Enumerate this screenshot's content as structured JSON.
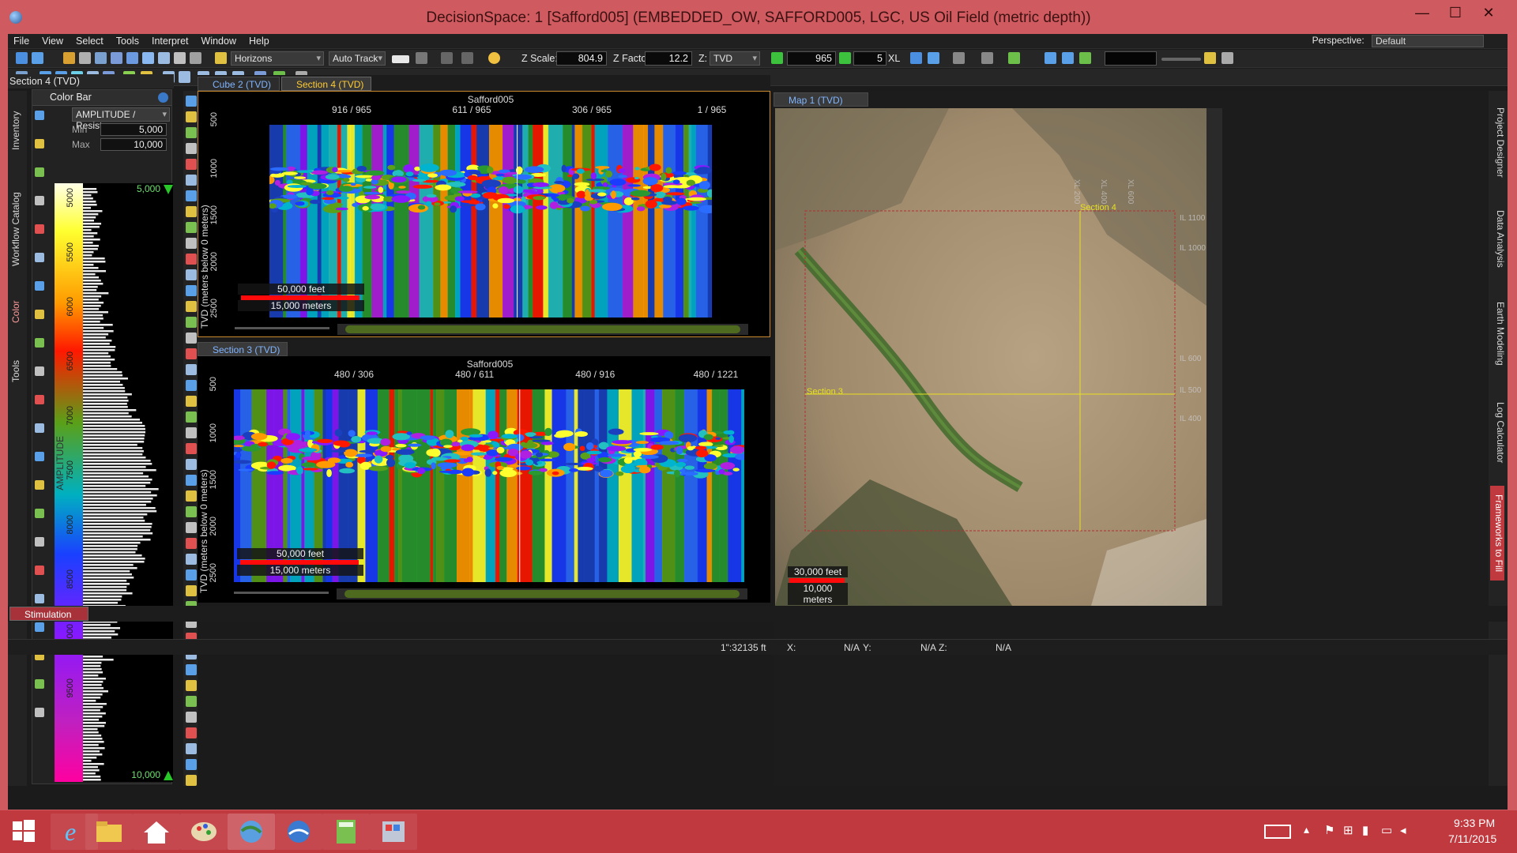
{
  "window": {
    "title": "DecisionSpace: 1 [Safford005] (EMBEDDED_OW, SAFFORD005, LGC, US Oil Field (metric depth))",
    "minimize": "—",
    "maximize": "☐",
    "close": "✕"
  },
  "menu": {
    "items": [
      "File",
      "View",
      "Select",
      "Tools",
      "Interpret",
      "Window",
      "Help"
    ],
    "perspective_label": "Perspective:",
    "perspective_value": "Default"
  },
  "toolbar": {
    "horizons": "Horizons",
    "auto_track": "Auto Track",
    "z_scale_label": "Z Scale:",
    "z_scale_value": "804.9",
    "z_factor_label": "Z Factor:",
    "z_factor_value": "12.2",
    "z_label": "Z:",
    "z_value": "TVD",
    "line_value": "965",
    "step_value": "5",
    "xl_label": "XL"
  },
  "left": {
    "section_title": "Section 4 (TVD)",
    "vertical_tabs": [
      "Inventory",
      "Workflow Catalog",
      "Color",
      "Tools"
    ],
    "color_bar": {
      "title": "Color Bar",
      "attribute": "AMPLITUDE / Resist...",
      "min_label": "Min",
      "min_value": "5,000",
      "max_label": "Max",
      "max_value": "10,000",
      "top_value": "5,000",
      "bottom_value": "10,000",
      "axis_label": "AMPLITUDE",
      "ticks": [
        "5000",
        "5500",
        "6000",
        "6500",
        "7000",
        "7500",
        "8000",
        "8500",
        "9000",
        "9500"
      ]
    }
  },
  "section4": {
    "tabs": [
      "Cube 2 (TVD)",
      "Section 4 (TVD)"
    ],
    "well": "Safford005",
    "top_ticks": [
      "916 / 965",
      "611 / 965",
      "306 / 965",
      "1 / 965"
    ],
    "y_label": "TVD (meters below 0 meters)",
    "y_ticks": [
      "500",
      "1000",
      "1500",
      "2000",
      "2500"
    ],
    "scale_feet": "50,000 feet",
    "scale_meters": "15,000 meters"
  },
  "section3": {
    "tab": "Section 3 (TVD)",
    "well": "Safford005",
    "top_ticks": [
      "480 / 306",
      "480 / 611",
      "480 / 916",
      "480 / 1221"
    ],
    "y_label": "TVD (meters below 0 meters)",
    "y_ticks": [
      "500",
      "1000",
      "1500",
      "2000",
      "2500"
    ],
    "scale_feet": "50,000 feet",
    "scale_meters": "15,000 meters"
  },
  "map": {
    "tab": "Map 1 (TVD)",
    "section4_label": "Section 4",
    "section3_label": "Section 3",
    "il_ticks": [
      "IL 1100",
      "IL 1000",
      "IL 600",
      "IL 500",
      "IL 400"
    ],
    "xl_ticks": [
      "XL 200",
      "XL 400",
      "XL 600"
    ],
    "scale_feet": "30,000 feet",
    "scale_meters": "10,000 meters"
  },
  "right_rail": [
    "Project Designer",
    "Data Analysis",
    "Earth Modeling",
    "Log Calculator",
    "Frameworks to Fill"
  ],
  "bottom": {
    "stimulation_tab": "Stimulation",
    "scale_readout": "1\":32135 ft",
    "x_label": "X:",
    "x_value": "N/A",
    "y_label": "Y:",
    "y_value": "N/A",
    "z_label": "Z:",
    "z_value": "N/A"
  },
  "taskbar": {
    "time": "9:33 PM",
    "date": "7/11/2015"
  }
}
